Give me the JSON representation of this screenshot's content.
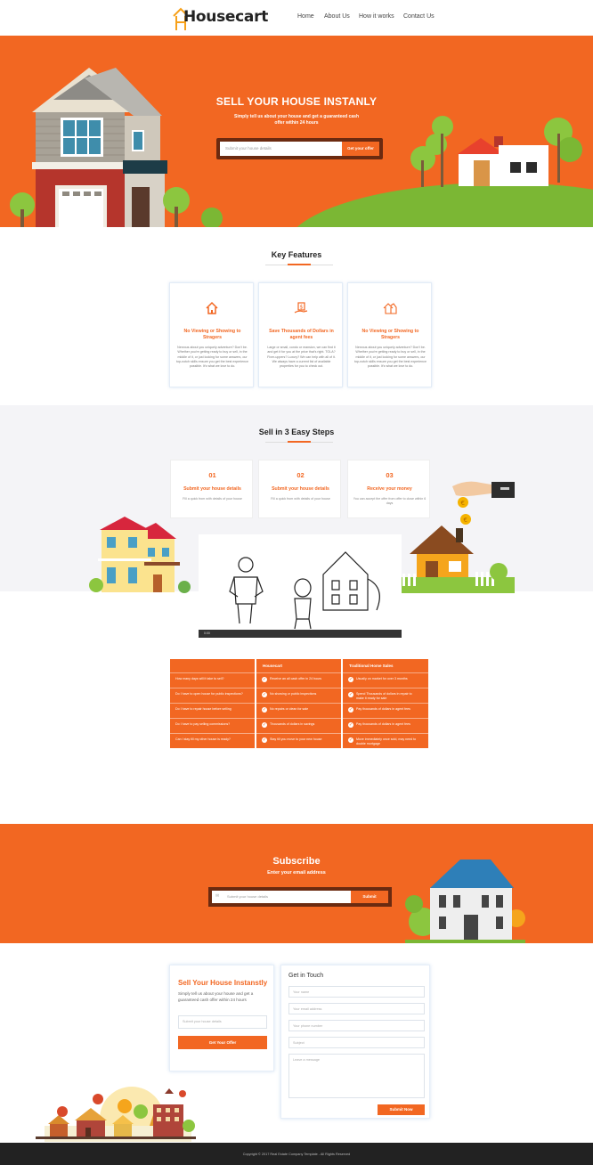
{
  "brand": {
    "name": "Housecart",
    "accent": "#f26722",
    "dark_accent": "#6b2a10"
  },
  "nav": {
    "items": [
      "Home",
      "About Us",
      "How it works",
      "Contact Us"
    ]
  },
  "hero": {
    "title": "SELL YOUR HOUSE INSTANLY",
    "subtitle": "Simply tell us about your house and get a guaranteed cash offer within 24 hours",
    "placeholder": "Submit your house details",
    "button": "Get your offer"
  },
  "features": {
    "title": "Key Features",
    "cards": [
      {
        "icon": "house-icon",
        "title": "No Viewing or Showing to Stragers",
        "text": "Nervous about you uniquely adventure? Don't be. Whether you're getting ready to buy or sell, in the middle of it, or just looking for some answers, our top-notch skills ensure you get the best experience possible. It's what we love to do."
      },
      {
        "icon": "money-hand-icon",
        "title": "Save Thousands of Dollars in agent fees",
        "text": "Large or small, condo or mansion, we can find it and get it for you at the price that's right. TOLA? Fixer-uppers? Luxury? We can help with all of it. We always have a current list of available properties for you to check out."
      },
      {
        "icon": "home-outline-icon",
        "title": "No Viewing or Showing to Stragers",
        "text": "Nervous about you uniquely adventure? Don't be. Whether you're getting ready to buy or sell, in the middle of it, or just looking for some answers, our top-notch skills ensure you get the best experience possible. It's what we love to do."
      }
    ]
  },
  "steps": {
    "title": "Sell in 3 Easy Steps",
    "items": [
      {
        "num": "01",
        "title": "Submit your house details",
        "text": "Fill a quick from with details of your house"
      },
      {
        "num": "02",
        "title": "Submit your house details",
        "text": "Fill a quick from with details of your house"
      },
      {
        "num": "03",
        "title": "Receive your money",
        "text": "You can accept the offer from offer to close within 6 days"
      }
    ]
  },
  "video": {
    "label": "0:00"
  },
  "comparison": {
    "headers": [
      "",
      "Housecart",
      "Traditional Home Sales"
    ],
    "questions": [
      "How many days will it take to sell?",
      "Do I have to open house for public inspections?",
      "Do I have to repair house before selling",
      "Do I have to pay selling commissions?",
      "Can I stay till my other house is ready?"
    ],
    "housecart": [
      "Receive an all cash offer in 24 hours",
      "No showing or public inspections",
      "No repairs or clean for sale",
      "Thousands of dollars in savings",
      "Stay till you move to your new house"
    ],
    "traditional": [
      "Usually on market for over 3 months",
      "Spend Thousands of dollars in repair to make it ready for sale",
      "Pay thousands of dollars in agent fees",
      "Pay thousands of dollars in agent fees",
      "Move immediately once sold, may need to double mortgage"
    ]
  },
  "subscribe": {
    "title": "Subscribe",
    "subtitle": "Enter your email address",
    "placeholder": "Submit your house details",
    "button": "Submit"
  },
  "sell_card": {
    "title": "Sell Your House Instanstly",
    "text": "Simply tell us about your house and get a guaranteed cash offer within 24 hours",
    "placeholder": "Submit your house details",
    "button": "Get Your Offer"
  },
  "contact": {
    "title": "Get in Touch",
    "name": "Your name",
    "email": "Your email address",
    "phone": "Your phone number",
    "subject": "Subject",
    "message": "Leave a message",
    "button": "Submit Now"
  },
  "footer": {
    "text": "Copyright © 2017 Real Estate Company Template - All Rights Reserved"
  }
}
